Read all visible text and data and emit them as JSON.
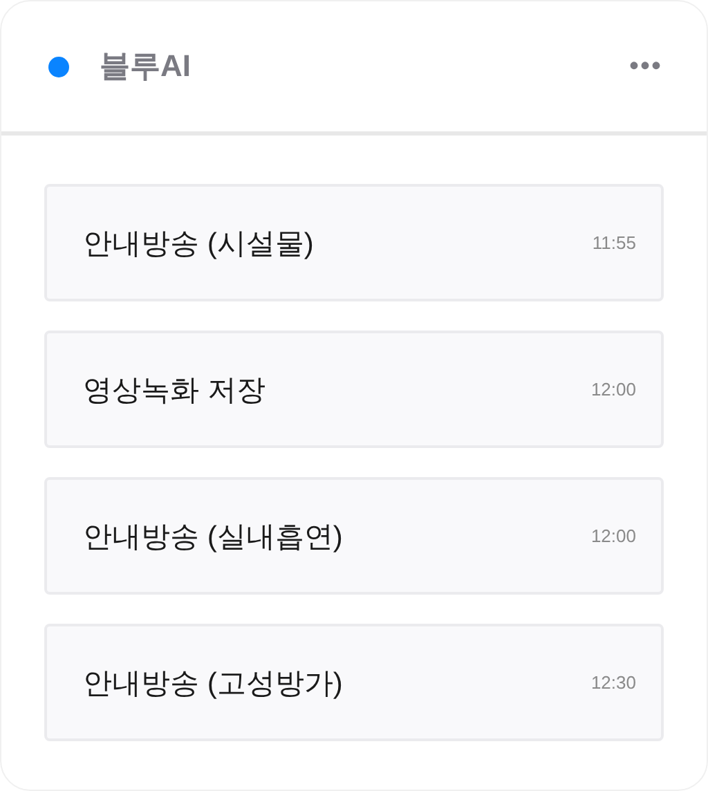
{
  "header": {
    "title": "블루AI",
    "menu_icon": "•••"
  },
  "items": [
    {
      "title": "안내방송 (시설물)",
      "time": "11:55"
    },
    {
      "title": "영상녹화 저장",
      "time": "12:00"
    },
    {
      "title": "안내방송 (실내흡연)",
      "time": "12:00"
    },
    {
      "title": "안내방송 (고성방가)",
      "time": "12:30"
    }
  ]
}
